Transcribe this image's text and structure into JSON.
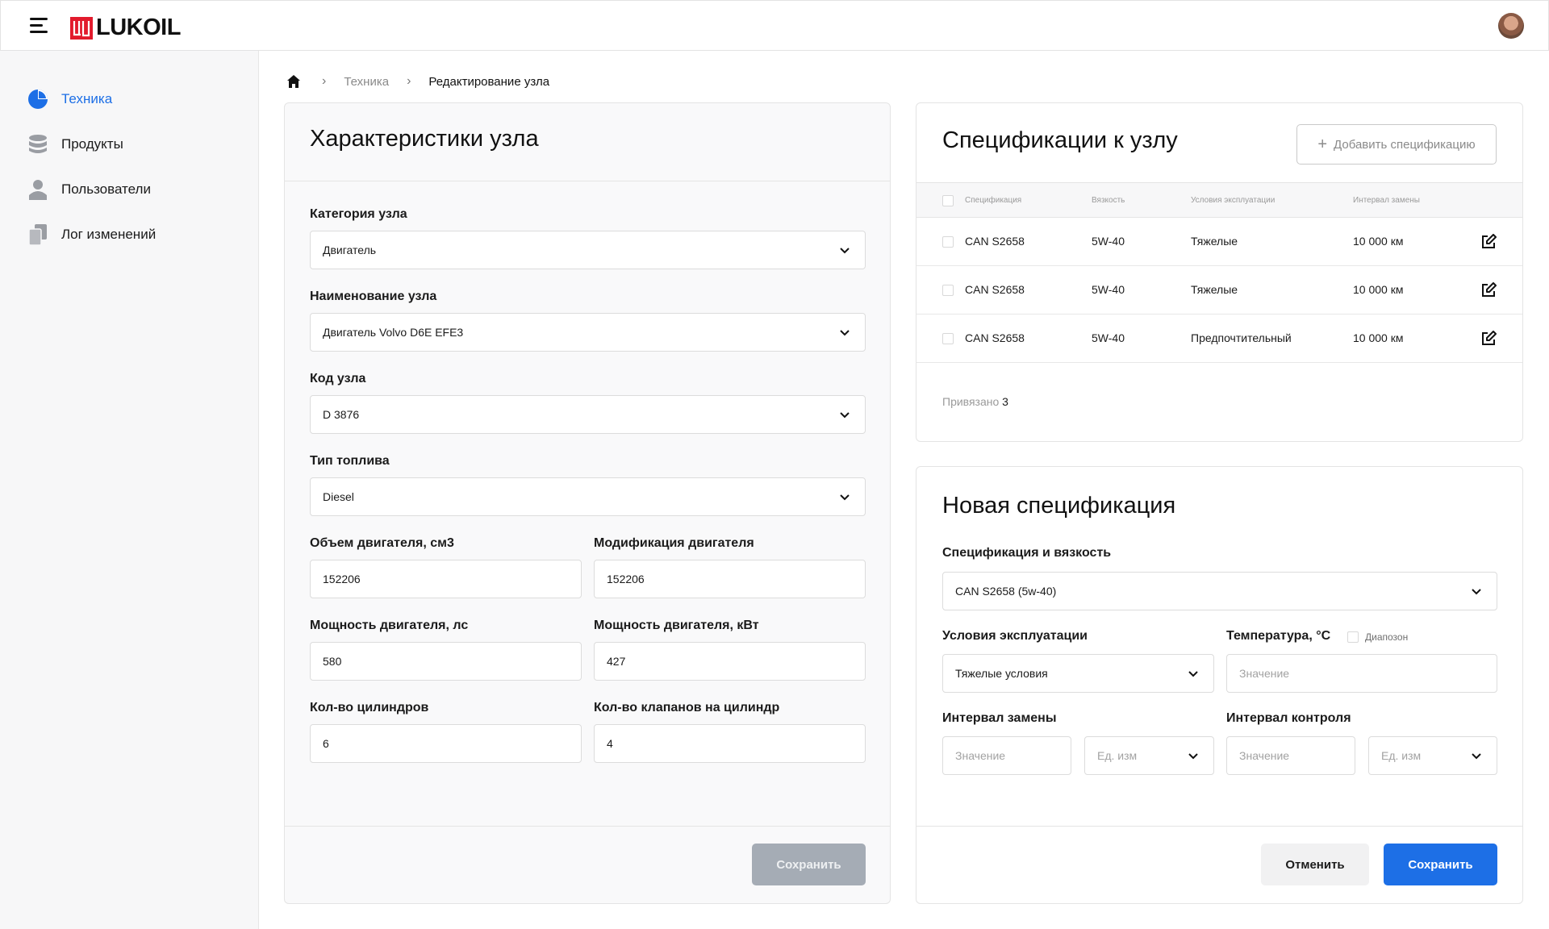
{
  "header": {
    "logo_text": "LUKOIL",
    "brand_color": "#e21a2c"
  },
  "sidebar": {
    "items": [
      {
        "label": "Техника",
        "icon": "pie-chart-icon",
        "active": true
      },
      {
        "label": "Продукты",
        "icon": "database-icon",
        "active": false
      },
      {
        "label": "Пользователи",
        "icon": "user-icon",
        "active": false
      },
      {
        "label": "Лог изменений",
        "icon": "documents-icon",
        "active": false
      }
    ],
    "accent_color": "#1d6fe6"
  },
  "breadcrumb": {
    "home_icon": "home-icon",
    "items": [
      "Техника",
      "Редактирование узла"
    ]
  },
  "node_form": {
    "title": "Характеристики узла",
    "category": {
      "label": "Категория узла",
      "value": "Двигатель"
    },
    "name": {
      "label": "Наименование узла",
      "value": "Двигатель Volvo D6E EFE3"
    },
    "code": {
      "label": "Код узла",
      "value": "D 3876"
    },
    "fuel": {
      "label": "Тип топлива",
      "value": "Diesel"
    },
    "volume": {
      "label": "Объем двигателя, см3",
      "value": "152206"
    },
    "modification": {
      "label": "Модификация двигателя",
      "value": "152206"
    },
    "power_hp": {
      "label": "Мощность двигателя, лс",
      "value": "580"
    },
    "power_kw": {
      "label": "Мощность двигателя, кВт",
      "value": "427"
    },
    "cylinders": {
      "label": "Кол-во цилиндров",
      "value": "6"
    },
    "valves": {
      "label": "Кол-во клапанов на цилиндр",
      "value": "4"
    },
    "save_label": "Сохранить"
  },
  "specs": {
    "title": "Спецификации к узлу",
    "add_label": "Добавить спецификацию",
    "columns": [
      "Спецификация",
      "Вязкость",
      "Условия эксплуатации",
      "Интервал замены"
    ],
    "rows": [
      {
        "spec": "CAN S2658",
        "viscosity": "5W-40",
        "conditions": "Тяжелые",
        "interval": "10 000 км"
      },
      {
        "spec": "CAN S2658",
        "viscosity": "5W-40",
        "conditions": "Тяжелые",
        "interval": "10 000 км"
      },
      {
        "spec": "CAN S2658",
        "viscosity": "5W-40",
        "conditions": "Предпочтительный",
        "interval": "10 000 км"
      }
    ],
    "bound_label": "Привязано",
    "bound_count": "3"
  },
  "new_spec": {
    "title": "Новая спецификация",
    "spec_viscosity": {
      "label": "Спецификация и вязкость",
      "value": "CAN S2658 (5w-40)"
    },
    "conditions": {
      "label": "Условия эксплуатации",
      "value": "Тяжелые условия"
    },
    "temperature": {
      "label": "Температура, °C",
      "placeholder": "Значение",
      "range_label": "Диапозон"
    },
    "replace_interval": {
      "label": "Интервал замены",
      "placeholder": "Значение",
      "unit_placeholder": "Ед. изм"
    },
    "control_interval": {
      "label": "Интервал контроля",
      "placeholder": "Значение",
      "unit_placeholder": "Ед. изм"
    },
    "cancel_label": "Отменить",
    "save_label": "Сохранить"
  }
}
